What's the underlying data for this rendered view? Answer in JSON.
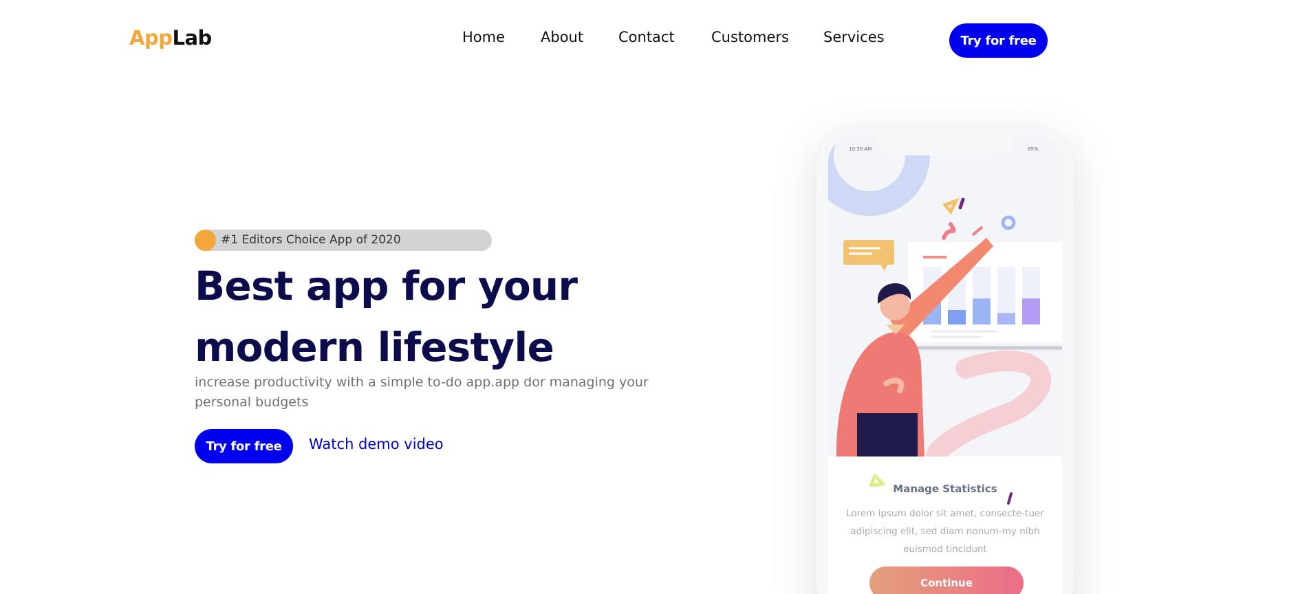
{
  "brand": {
    "logo_part1": "App",
    "logo_part2": "Lab",
    "accent": "#f3a73b",
    "primary": "#0000ee"
  },
  "nav": {
    "items": [
      "Home",
      "About",
      "Contact",
      "Customers",
      "Services"
    ],
    "cta_label": "Try for free"
  },
  "hero": {
    "badge": "#1 Editors Choice App of 2020",
    "title_line1": "Best app for your",
    "title_line2": "modern lifestyle",
    "subtitle": "increase productivity with a simple to-do app.app dor managing your personal budgets",
    "cta_label": "Try for free",
    "secondary_link": "Watch demo video"
  },
  "phone": {
    "status_time": "10:30 AM",
    "status_battery": "85%",
    "card_title": "Manage Statistics",
    "card_text": "Lorem ipsum dolor sit amet, consecte-tuer adipiscing elit, sed diam nonum-my nibh euismod tincidunt",
    "continue_label": "Continue",
    "chart_bars": [
      0.4,
      0.25,
      0.45,
      0.2,
      0.45
    ]
  }
}
